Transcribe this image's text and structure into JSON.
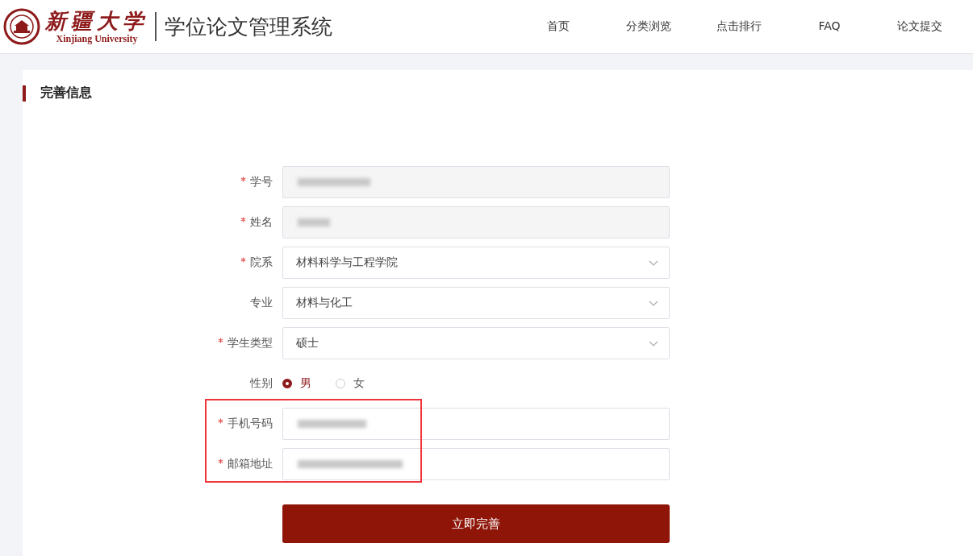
{
  "header": {
    "logo": {
      "name_cn": "新疆大学",
      "name_en": "Xinjiang University"
    },
    "title": "学位论文管理系统",
    "nav": [
      {
        "label": "首页",
        "selected": false
      },
      {
        "label": "分类浏览",
        "selected": false
      },
      {
        "label": "点击排行",
        "selected": false
      },
      {
        "label": "FAQ",
        "selected": false
      },
      {
        "label": "论文提交",
        "selected": false
      }
    ]
  },
  "section_title": "完善信息",
  "form": {
    "fields": [
      {
        "label": "学号",
        "required": true,
        "kind": "text",
        "disabled": true,
        "redacted": true,
        "highlighted": false
      },
      {
        "label": "姓名",
        "required": true,
        "kind": "text",
        "disabled": true,
        "redacted": true,
        "highlighted": false
      },
      {
        "label": "院系",
        "required": true,
        "kind": "select",
        "value": "材料科学与工程学院",
        "highlighted": false
      },
      {
        "label": "专业",
        "required": false,
        "kind": "select",
        "value": "材料与化工",
        "highlighted": false
      },
      {
        "label": "学生类型",
        "required": true,
        "kind": "select",
        "value": "硕士",
        "highlighted": false
      },
      {
        "label": "性别",
        "required": false,
        "kind": "radio",
        "options": [
          {
            "label": "男",
            "selected": true
          },
          {
            "label": "女",
            "selected": false
          }
        ],
        "highlighted": false
      },
      {
        "label": "手机号码",
        "required": true,
        "kind": "text",
        "disabled": false,
        "redacted": true,
        "highlighted": true
      },
      {
        "label": "邮箱地址",
        "required": true,
        "kind": "text",
        "disabled": false,
        "redacted": true,
        "highlighted": true
      }
    ],
    "submit": "立即完善"
  }
}
